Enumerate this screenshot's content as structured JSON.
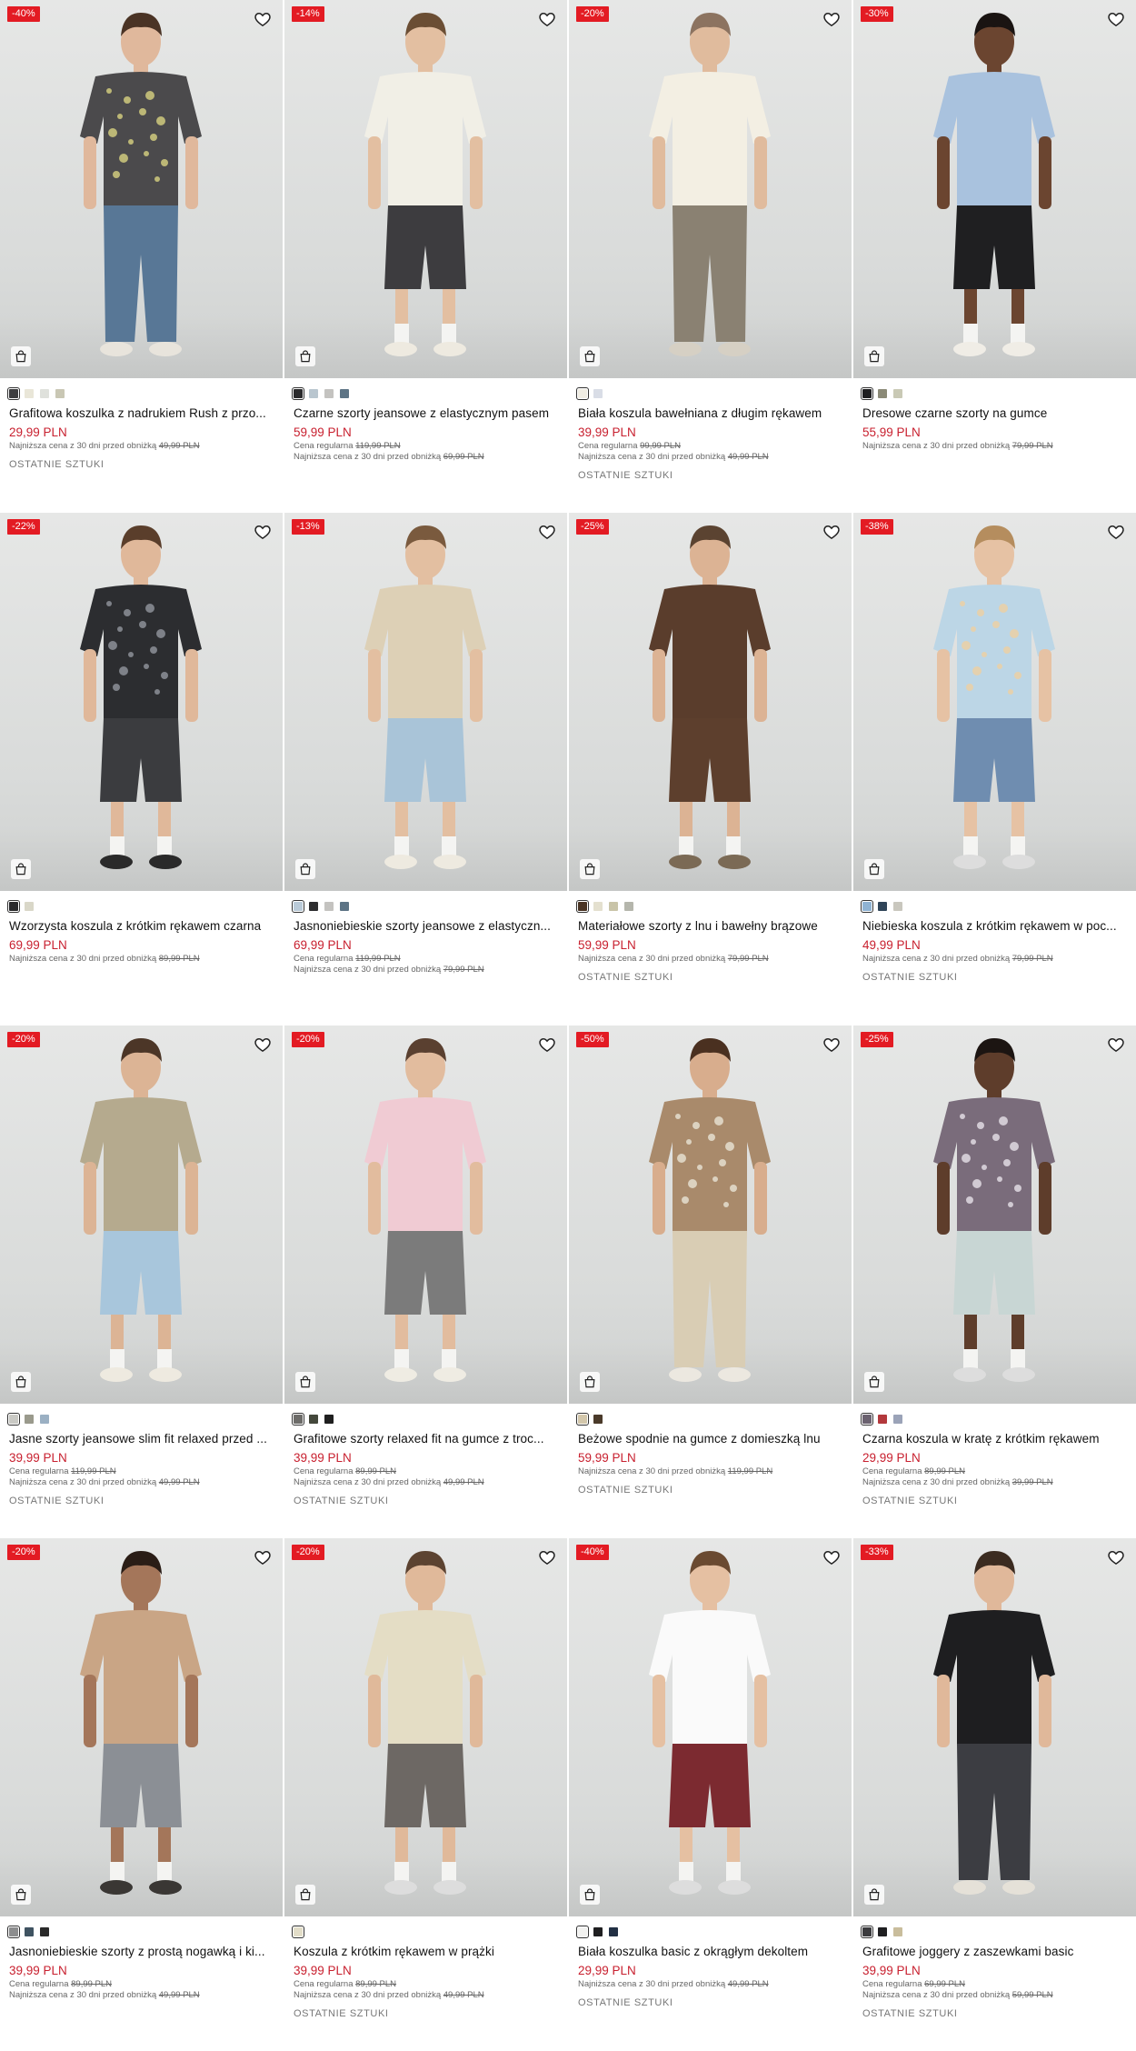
{
  "labels": {
    "regular_prefix": "Cena regularna",
    "lowest_prefix": "Najniższa cena z 30 dni przed obniżką",
    "last_items": "OSTATNIE SZTUKI",
    "favorite_icon": "heart-icon",
    "bag_icon": "shopping-bag-icon"
  },
  "products": [
    {
      "badge": "-40%",
      "name": "Grafitowa koszulka z nadrukiem Rush z przo...",
      "price": "29,99 PLN",
      "regular": "",
      "lowest": "49,99 PLN",
      "last": true,
      "swatches": [
        "#3d3d3f",
        "#e9e6d8",
        "#dfe1dc",
        "#c9c7b4"
      ],
      "top": "#4b4a4c",
      "bottom": "#587796",
      "skin": "#e0b89c",
      "hair": "#4a3325",
      "shoes": "#e8e4dc",
      "print": "#e2dc84"
    },
    {
      "badge": "-14%",
      "name": "Czarne szorty jeansowe z elastycznym pasem",
      "price": "59,99 PLN",
      "regular": "119,99 PLN",
      "lowest": "69,99 PLN",
      "last": false,
      "swatches": [
        "#2b2b2d",
        "#b9c6cf",
        "#c4c3c0",
        "#5d7485"
      ],
      "top": "#f1efe6",
      "bottom": "#3d3c3f",
      "skin": "#e3bfa1",
      "hair": "#6b4e34",
      "shoes": "#eeeae0"
    },
    {
      "badge": "-20%",
      "name": "Biała koszula bawełniana z długim rękawem",
      "price": "39,99 PLN",
      "regular": "99,99 PLN",
      "lowest": "49,99 PLN",
      "last": true,
      "swatches": [
        "#f0ede3",
        "#d9dde6"
      ],
      "top": "#f3efe3",
      "bottom": "#8a8172",
      "skin": "#e0bb9d",
      "hair": "#8c7360",
      "shoes": "#d6d0c4"
    },
    {
      "badge": "-30%",
      "name": "Dresowe czarne szorty na gumce",
      "price": "55,99 PLN",
      "regular": "",
      "lowest": "79,99 PLN",
      "last": false,
      "swatches": [
        "#1e1e20",
        "#8b8a77",
        "#c9c9b5"
      ],
      "top": "#a9c2de",
      "bottom": "#1f1f21",
      "skin": "#6b4530",
      "hair": "#1a1412",
      "shoes": "#f0ede6"
    },
    {
      "badge": "-22%",
      "name": "Wzorzysta koszula z krótkim rękawem czarna",
      "price": "69,99 PLN",
      "regular": "",
      "lowest": "89,99 PLN",
      "last": false,
      "swatches": [
        "#2a2a2c",
        "#d9d7c8"
      ],
      "top": "#2c2d30",
      "bottom": "#3b3c3f",
      "skin": "#e0b89a",
      "hair": "#5a3e2b",
      "shoes": "#2a2a2a",
      "print": "#9a9ea6"
    },
    {
      "badge": "-13%",
      "name": "Jasnoniebieskie szorty jeansowe z elastyczn...",
      "price": "69,99 PLN",
      "regular": "119,99 PLN",
      "lowest": "79,99 PLN",
      "last": false,
      "swatches": [
        "#b9cad8",
        "#2d2d2f",
        "#c4c3c0",
        "#5d7485"
      ],
      "top": "#ddd0b6",
      "bottom": "#a9c4d8",
      "skin": "#e3bfa1",
      "hair": "#7a5a3e",
      "shoes": "#eeeae0"
    },
    {
      "badge": "-25%",
      "name": "Materiałowe szorty z lnu i bawełny brązowe",
      "price": "59,99 PLN",
      "regular": "",
      "lowest": "79,99 PLN",
      "last": true,
      "swatches": [
        "#4a3424",
        "#e4e0cf",
        "#c9c4a8",
        "#b5b6ac"
      ],
      "top": "#5a3d2c",
      "bottom": "#5d3f2d",
      "skin": "#dcb394",
      "hair": "#5b4331",
      "shoes": "#7b6a55"
    },
    {
      "badge": "-38%",
      "name": "Niebieska koszula z krótkim rękawem w poc...",
      "price": "49,99 PLN",
      "regular": "",
      "lowest": "79,99 PLN",
      "last": true,
      "swatches": [
        "#8fb3d3",
        "#2f4458",
        "#c9c7be"
      ],
      "top": "#bcd6e6",
      "bottom": "#6f8db0",
      "skin": "#e6c2a4",
      "hair": "#b58d5e",
      "shoes": "#ddd",
      "print": "#f2cf9c"
    },
    {
      "badge": "-20%",
      "name": "Jasne szorty jeansowe slim fit relaxed przed ...",
      "price": "39,99 PLN",
      "regular": "119,99 PLN",
      "lowest": "49,99 PLN",
      "last": true,
      "swatches": [
        "#c9c9c4",
        "#9a9a8c",
        "#9bb0c3"
      ],
      "top": "#b5aa8e",
      "bottom": "#a8c6dc",
      "skin": "#dcb495",
      "hair": "#4c3627",
      "shoes": "#eeeae0"
    },
    {
      "badge": "-20%",
      "name": "Grafitowe szorty relaxed fit na gumce z troc...",
      "price": "39,99 PLN",
      "regular": "89,99 PLN",
      "lowest": "49,99 PLN",
      "last": true,
      "swatches": [
        "#6d6c69",
        "#44483b",
        "#1f1f1f"
      ],
      "top": "#f0cbd3",
      "bottom": "#7b7b7b",
      "skin": "#e2bc9e",
      "hair": "#5a4030",
      "shoes": "#efece3"
    },
    {
      "badge": "-50%",
      "name": "Beżowe spodnie na gumce z domieszką lnu",
      "price": "59,99 PLN",
      "regular": "",
      "lowest": "119,99 PLN",
      "last": true,
      "swatches": [
        "#d3c7ab",
        "#4a3a2a"
      ],
      "top": "#a98a6b",
      "bottom": "#d9cdb4",
      "skin": "#d8ad8d",
      "hair": "#4a3020",
      "shoes": "#ece8e0",
      "print": "#eee9dc"
    },
    {
      "badge": "-25%",
      "name": "Czarna koszula w kratę z krótkim rękawem",
      "price": "29,99 PLN",
      "regular": "89,99 PLN",
      "lowest": "39,99 PLN",
      "last": true,
      "swatches": [
        "#6b6270",
        "#b3383c",
        "#9ba3b8"
      ],
      "top": "#7a6c7b",
      "bottom": "#c8d6d4",
      "skin": "#5e3d2b",
      "hair": "#1c1512",
      "shoes": "#ddd",
      "print": "#efeaf0"
    },
    {
      "badge": "-20%",
      "name": "Jasnoniebieskie szorty z prostą nogawką i ki...",
      "price": "39,99 PLN",
      "regular": "89,99 PLN",
      "lowest": "49,99 PLN",
      "last": false,
      "swatches": [
        "#8c8d8e",
        "#3f5361",
        "#2a2a2a"
      ],
      "top": "#c9a585",
      "bottom": "#8b8f95",
      "skin": "#a4765a",
      "hair": "#2a1d16",
      "shoes": "#3a3734"
    },
    {
      "badge": "-20%",
      "name": "Koszula z krótkim rękawem w prążki",
      "price": "39,99 PLN",
      "regular": "89,99 PLN",
      "lowest": "49,99 PLN",
      "last": true,
      "swatches": [
        "#e2ddc8"
      ],
      "top": "#e4ddc5",
      "bottom": "#6d6864",
      "skin": "#e0b99a",
      "hair": "#5c4331",
      "shoes": "#ddd"
    },
    {
      "badge": "-40%",
      "name": "Biała koszulka basic z okrągłym dekoltem",
      "price": "29,99 PLN",
      "regular": "",
      "lowest": "49,99 PLN",
      "last": true,
      "swatches": [
        "#f2f2f0",
        "#1f1f21",
        "#223044"
      ],
      "top": "#fafafa",
      "bottom": "#7c2a30",
      "skin": "#e5c0a2",
      "hair": "#6a4a31",
      "shoes": "#ddd"
    },
    {
      "badge": "-33%",
      "name": "Grafitowe joggery z zaszewkami basic",
      "price": "39,99 PLN",
      "regular": "69,99 PLN",
      "lowest": "59,99 PLN",
      "last": true,
      "swatches": [
        "#3b3b3e",
        "#1f1f21",
        "#c9bd9c"
      ],
      "top": "#1e1e20",
      "bottom": "#3c3d42",
      "skin": "#e0b89a",
      "hair": "#3b2b20",
      "shoes": "#e5e1d8"
    }
  ]
}
